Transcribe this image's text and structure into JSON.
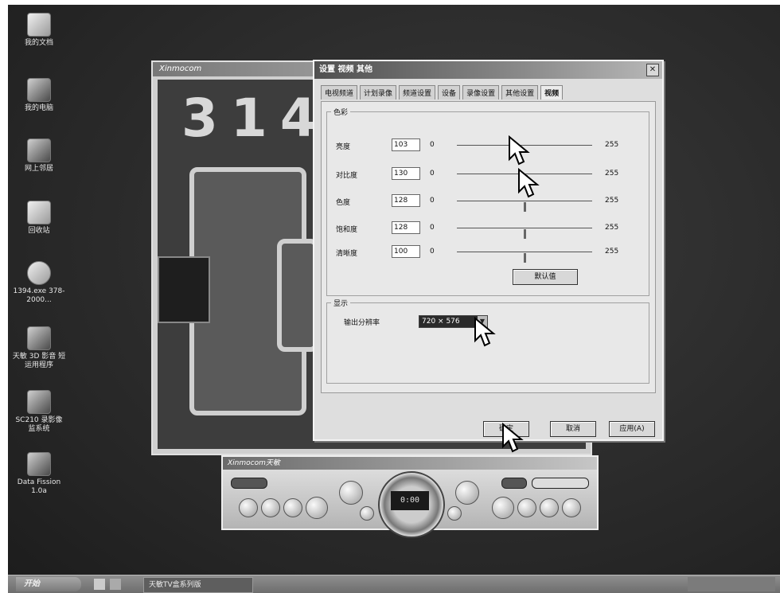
{
  "desktop": {
    "icons": [
      {
        "label": "我的文档",
        "icon": "folder-icon"
      },
      {
        "label": "我的电脑",
        "icon": "computer-icon"
      },
      {
        "label": "网上邻居",
        "icon": "network-icon"
      },
      {
        "label": "回收站",
        "icon": "recycle-bin-icon"
      },
      {
        "label": "1394.exe 378-2000...",
        "icon": "program-icon"
      },
      {
        "label": "天敏 3D 影音 短运用程序",
        "icon": "app-icon"
      },
      {
        "label": "SC210 录影像 监系统",
        "icon": "camera-app-icon"
      },
      {
        "label": "Data Fission 1.0a",
        "icon": "data-app-icon"
      }
    ]
  },
  "camera_window": {
    "title": "Xinmocom",
    "pcb_label": "314"
  },
  "dialog": {
    "title": "设置  视频  其他",
    "close": "✕",
    "tabs": [
      "电视频道",
      "计划录像",
      "频道设置",
      "设备",
      "录像设置",
      "其他设置",
      "视频"
    ],
    "active_tab_index": 6,
    "group_color": "色彩",
    "sliders": [
      {
        "label": "亮度",
        "value": "103",
        "min": "0",
        "max": "255",
        "position": 0.4
      },
      {
        "label": "对比度",
        "value": "130",
        "min": "0",
        "max": "255",
        "position": 0.51
      },
      {
        "label": "色度",
        "value": "128",
        "min": "0",
        "max": "255",
        "position": 0.5
      },
      {
        "label": "饱和度",
        "value": "128",
        "min": "0",
        "max": "255",
        "position": 0.5
      },
      {
        "label": "清晰度",
        "value": "100",
        "min": "0",
        "max": "255",
        "position": 0.5
      }
    ],
    "default_button": "默认值",
    "group_display": "显示",
    "output_resolution_label": "输出分辨率",
    "output_resolution_value": "720 × 576",
    "ok_button": "确定",
    "cancel_button": "取消",
    "apply_button": "应用(A)"
  },
  "player": {
    "title": "Xinmocom天敏",
    "display": "0:00"
  },
  "taskbar": {
    "start": "开始",
    "task": "天敏TV盒系列版"
  },
  "colors": {
    "desktop": "#2e2e2e",
    "dialog": "#dedede",
    "titlebar": "#505050"
  }
}
